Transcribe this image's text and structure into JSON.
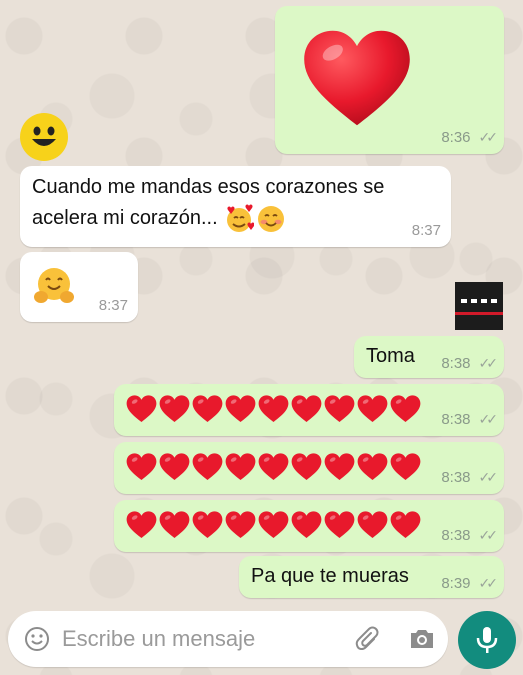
{
  "messages": [
    {
      "type": "outgoing",
      "content": "big-heart-emoji",
      "time": "8:36"
    },
    {
      "type": "incoming",
      "text_line1": "Cuando me mandas esos corazones se",
      "text_line2": "acelera mi corazón...",
      "emojis": [
        "smiling-face-with-hearts",
        "smiling-face-blush"
      ],
      "time": "8:37"
    },
    {
      "type": "incoming",
      "content": "hugging-face-emoji",
      "time": "8:37"
    },
    {
      "type": "outgoing",
      "text": "Toma",
      "time": "8:38"
    },
    {
      "type": "outgoing",
      "content": "9-red-hearts",
      "time": "8:38"
    },
    {
      "type": "outgoing",
      "content": "9-red-hearts",
      "time": "8:38"
    },
    {
      "type": "outgoing",
      "content": "9-red-hearts",
      "time": "8:38"
    },
    {
      "type": "outgoing",
      "text": "Pa que te mueras",
      "time": "8:39"
    }
  ],
  "composer": {
    "placeholder": "Escribe un mensaje",
    "icons": [
      "emoji-icon",
      "attach-icon",
      "camera-icon",
      "mic-icon"
    ]
  },
  "colors": {
    "outgoing_bubble": "#dcf8c6",
    "incoming_bubble": "#ffffff",
    "mic_button": "#128c7e",
    "heart": "#e8192c"
  }
}
